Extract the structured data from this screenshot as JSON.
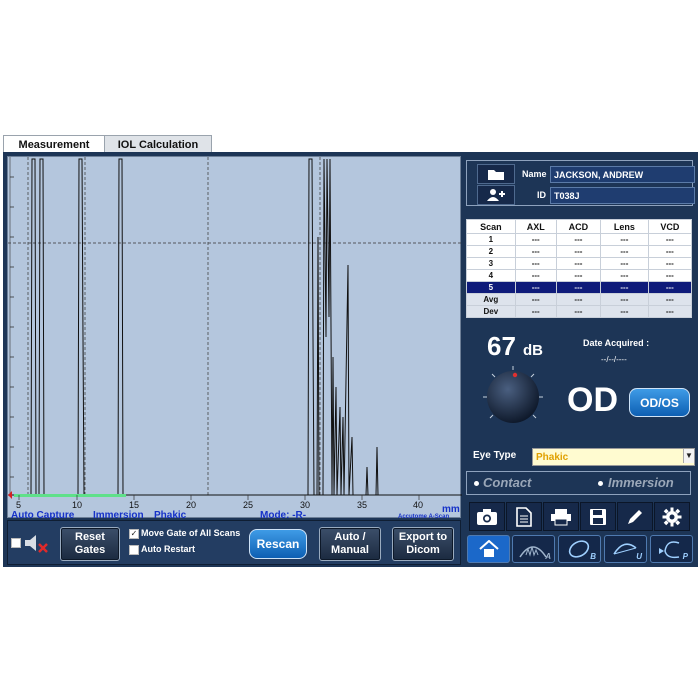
{
  "tabs": [
    {
      "label": "Measurement",
      "active": true
    },
    {
      "label": "IOL Calculation",
      "active": false
    }
  ],
  "plot": {
    "x_axis_unit": "mm",
    "x_ticks": [
      "5",
      "10",
      "15",
      "20",
      "25",
      "30",
      "35",
      "40"
    ],
    "status": {
      "capture": "Auto Capture",
      "probe": "Immersion",
      "lens": "Phakic",
      "mode": "Mode:  -R-",
      "brand": "Accutome A-Scan"
    }
  },
  "controls": {
    "reset_gates": [
      "Reset",
      "Gates"
    ],
    "move_gate_label": "Move Gate of All Scans",
    "move_gate_checked": true,
    "auto_restart_label": "Auto Restart",
    "auto_restart_checked": false,
    "rescan_label": "Rescan",
    "auto_manual": [
      "Auto /",
      "Manual"
    ],
    "export_dicom": [
      "Export to",
      "Dicom"
    ]
  },
  "patient": {
    "name_label": "Name",
    "name_value": "JACKSON, ANDREW",
    "id_label": "ID",
    "id_value": "T038J"
  },
  "scan_table": {
    "headers": [
      "Scan",
      "AXL",
      "ACD",
      "Lens",
      "VCD"
    ],
    "rows": [
      [
        "1",
        "---",
        "---",
        "---",
        "---"
      ],
      [
        "2",
        "---",
        "---",
        "---",
        "---"
      ],
      [
        "3",
        "---",
        "---",
        "---",
        "---"
      ],
      [
        "4",
        "---",
        "---",
        "---",
        "---"
      ],
      [
        "5",
        "---",
        "---",
        "---",
        "---"
      ]
    ],
    "selected_row": 4,
    "stats": [
      [
        "Avg",
        "---",
        "---",
        "---",
        "---"
      ],
      [
        "Dev",
        "---",
        "---",
        "---",
        "---"
      ]
    ]
  },
  "gain": {
    "value": "67",
    "unit": "dB"
  },
  "date_acquired": {
    "label": "Date Acquired :",
    "value": "--/--/----"
  },
  "eye": {
    "label": "OD",
    "toggle_label": "OD/OS"
  },
  "eye_type": {
    "label": "Eye Type",
    "value": "Phakic"
  },
  "probe_mode": {
    "contact": "Contact",
    "immersion": "Immersion"
  },
  "colors": {
    "panel_bg": "#1d3556",
    "plot_bg": "#b4c6dd",
    "status_text": "#1632c8",
    "accent_blue": "#1a6fd0",
    "selected_row": "#0e1b7a",
    "eye_type_text": "#e0a000"
  },
  "icons": {
    "toolbar": [
      "camera-icon",
      "document-icon",
      "printer-icon",
      "save-icon",
      "pencil-icon",
      "gear-icon"
    ],
    "modes": [
      "home-icon",
      "a-scan-mode-icon",
      "b-scan-mode-icon",
      "u-mode-icon",
      "p-mode-icon"
    ],
    "mode_letters": [
      "A",
      "B",
      "U",
      "P"
    ]
  }
}
